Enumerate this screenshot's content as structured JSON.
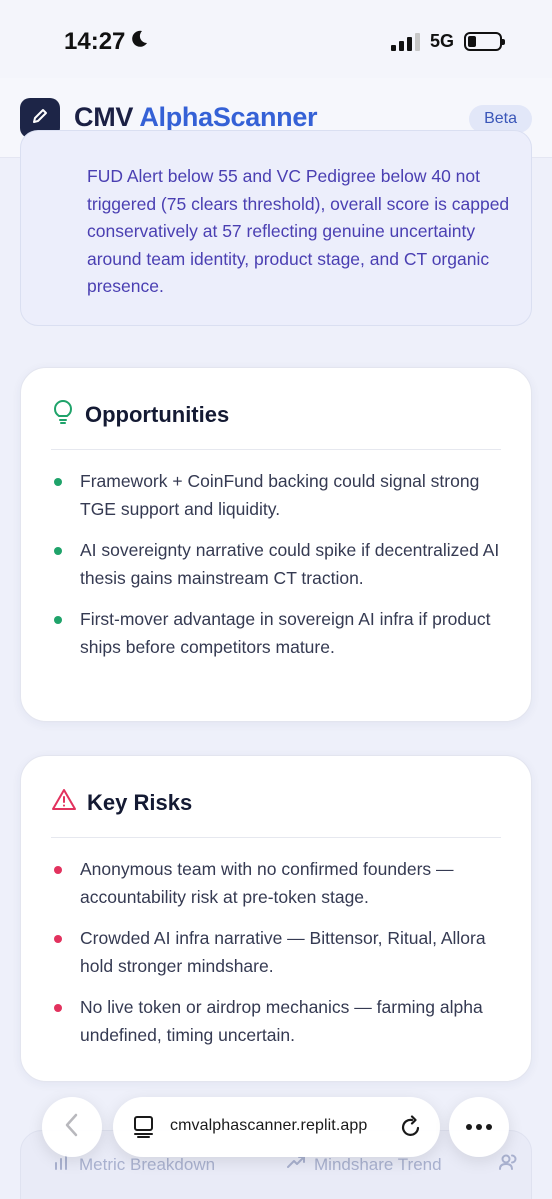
{
  "status_bar": {
    "time": "14:27",
    "network": "5G"
  },
  "header": {
    "title_part1": "CMV",
    "title_part2": "AlphaScanner",
    "badge": "Beta",
    "logo_icon": "pencil-icon"
  },
  "summary": {
    "text": "FUD Alert below 55 and VC Pedigree below 40 not triggered (75 clears threshold), overall score is capped conservatively at 57 reflecting genuine uncertainty around team identity, product stage, and CT organic presence."
  },
  "opportunities": {
    "title": "Opportunities",
    "icon": "lightbulb-icon",
    "accent": "#1fa36a",
    "items": [
      {
        "text": "Framework + CoinFund backing could signal strong TGE support and liquidity."
      },
      {
        "text": "AI sovereignty narrative could spike if decentralized AI thesis gains mainstream CT traction."
      },
      {
        "text": "First-mover advantage in sovereign AI infra if product ships before competitors mature."
      }
    ]
  },
  "risks": {
    "title": "Key Risks",
    "icon": "warning-icon",
    "accent": "#e2325e",
    "items": [
      {
        "text": "Anonymous team with no confirmed founders — accountability risk at pre-token stage."
      },
      {
        "text": "Crowded AI infra narrative — Bittensor, Ritual, Allora hold stronger mindshare."
      },
      {
        "text": "No live token or airdrop mechanics — farming alpha undefined, timing uncertain."
      }
    ]
  },
  "tabs": [
    {
      "label": "Metric Breakdown",
      "icon": "bar-chart-icon"
    },
    {
      "label": "Mindshare Trend",
      "icon": "trend-icon"
    },
    {
      "label": "",
      "icon": "users-icon"
    }
  ],
  "browser": {
    "url": "cmvalphascanner.replit.app"
  }
}
